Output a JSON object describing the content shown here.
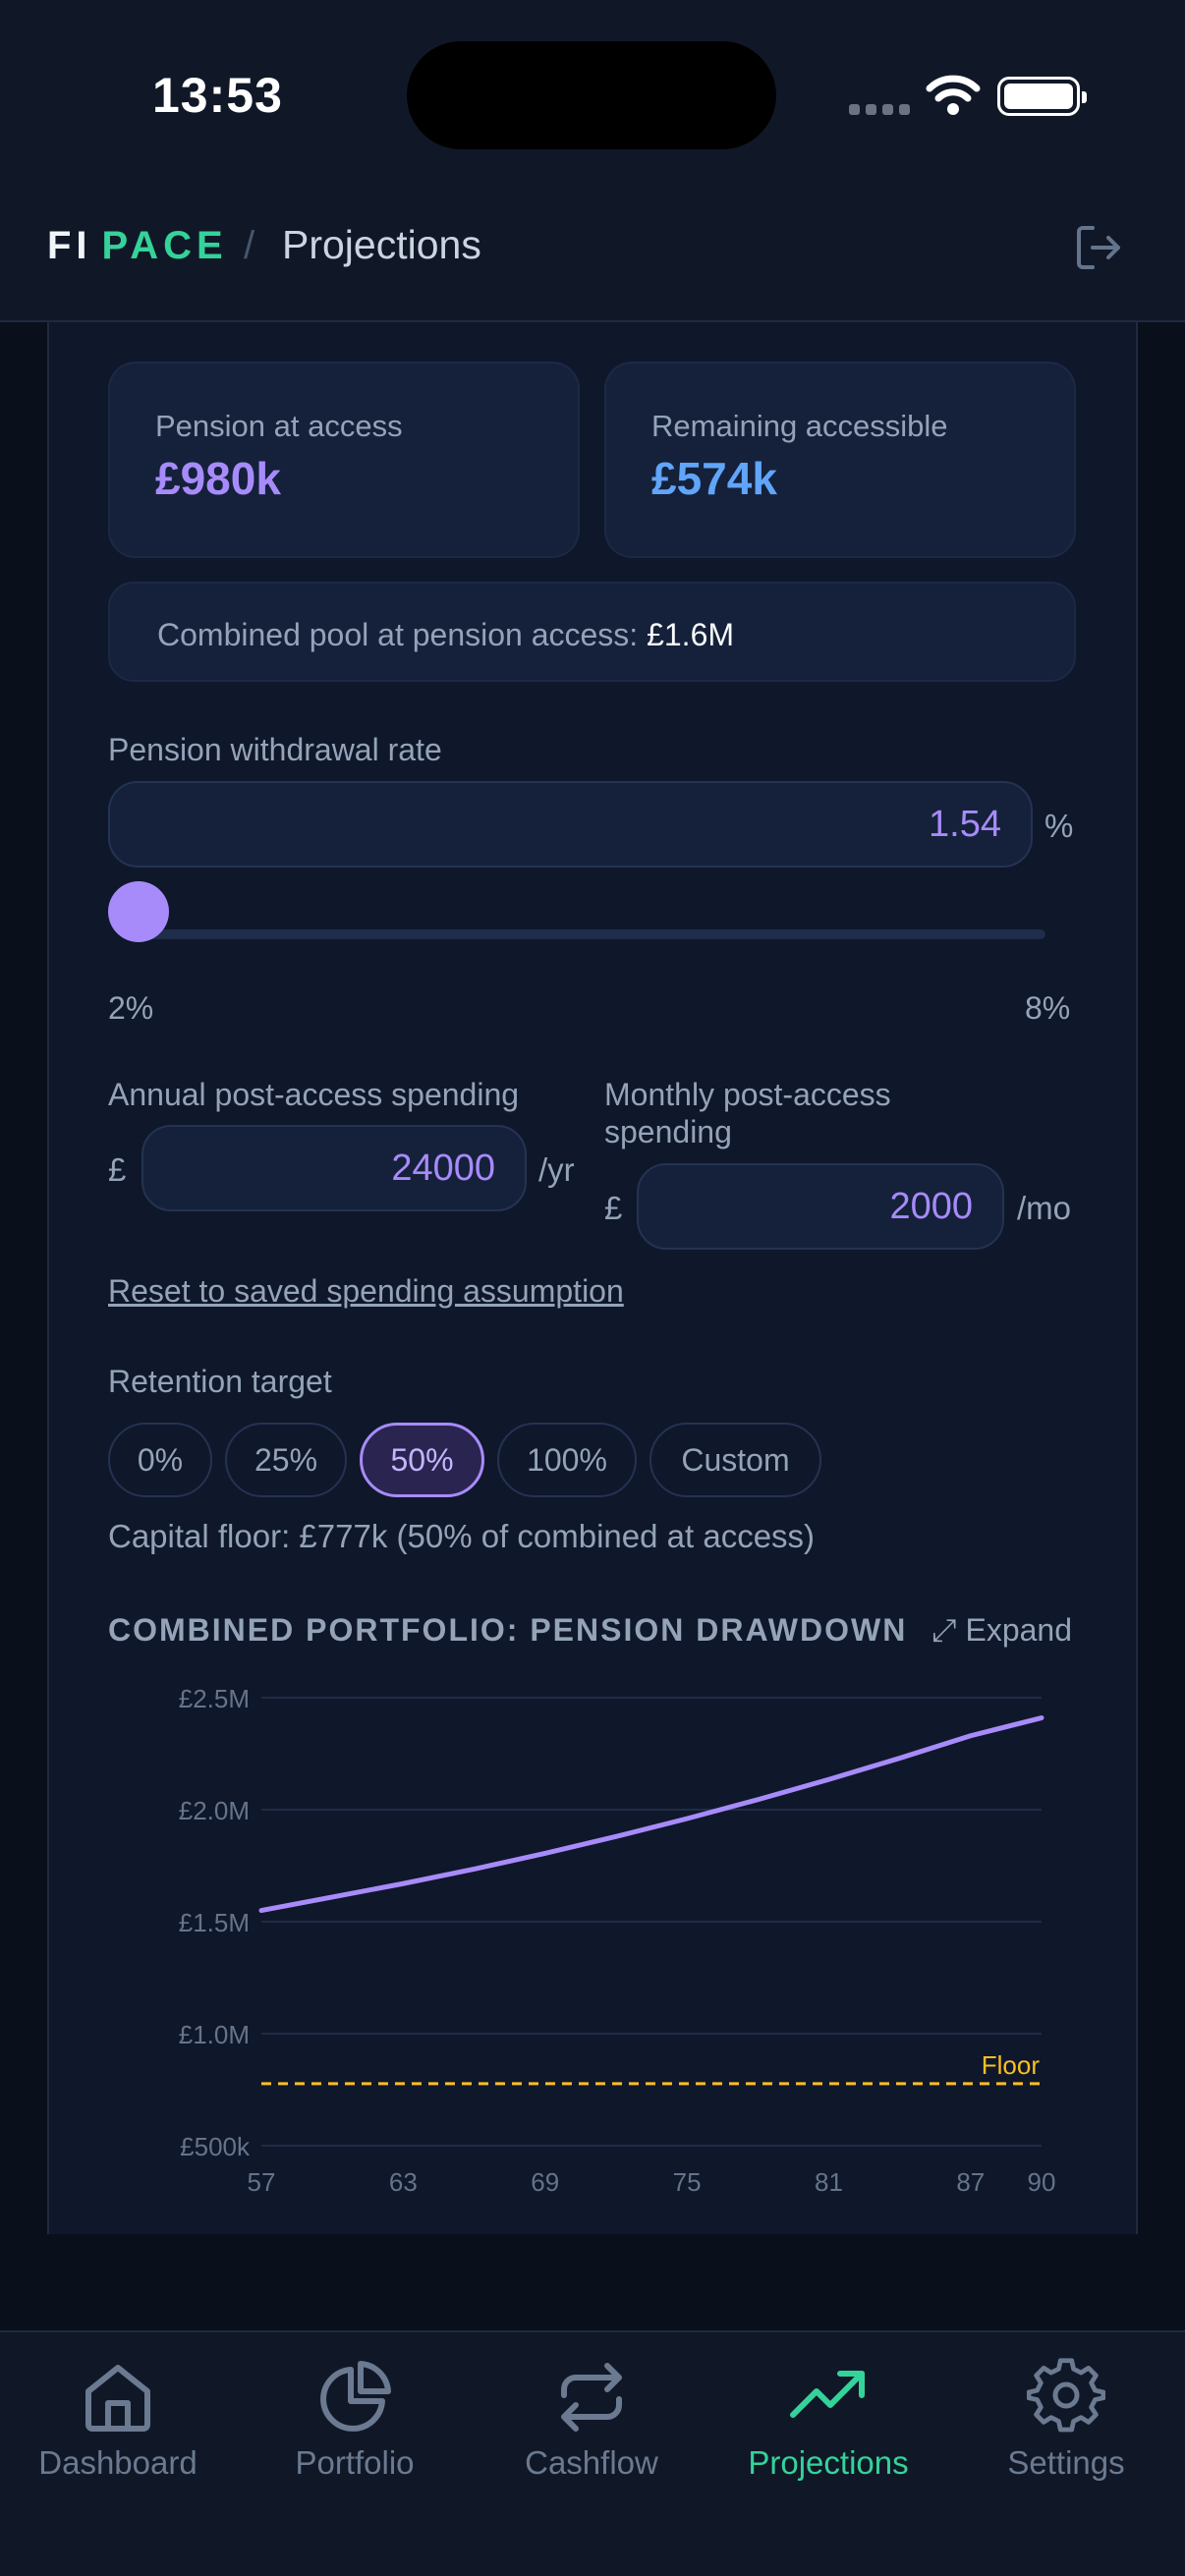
{
  "status": {
    "time": "13:53"
  },
  "header": {
    "brand_primary": "FI",
    "brand_accent": "PACE",
    "separator": "/",
    "page": "Projections"
  },
  "summary": {
    "pension_label": "Pension at access",
    "pension_value": "£980k",
    "remaining_label": "Remaining accessible",
    "remaining_value": "£574k",
    "combined_label": "Combined pool at pension access:",
    "combined_value": "£1.6M"
  },
  "withdrawal": {
    "label": "Pension withdrawal rate",
    "value": "1.54",
    "unit": "%",
    "min_label": "2%",
    "max_label": "8%",
    "slider_fraction": 0.0
  },
  "spending": {
    "annual_label": "Annual post-access spending",
    "annual_prefix": "£",
    "annual_value": "24000",
    "annual_unit": "/yr",
    "monthly_label_line1": "Monthly post-access",
    "monthly_label_line2": "spending",
    "monthly_prefix": "£",
    "monthly_value": "2000",
    "monthly_unit": "/mo",
    "reset_label": "Reset to saved spending assumption"
  },
  "retention": {
    "label": "Retention target",
    "options": [
      "0%",
      "25%",
      "50%",
      "100%",
      "Custom"
    ],
    "selected": "50%",
    "floor_text": "Capital floor: £777k (50% of combined at access)"
  },
  "chart_section": {
    "title": "COMBINED PORTFOLIO: PENSION DRAWDOWN",
    "expand_label": "⤢ Expand"
  },
  "chart_data": {
    "type": "line",
    "title": "COMBINED PORTFOLIO: PENSION DRAWDOWN",
    "xlabel": "",
    "ylabel": "",
    "x_ticks": [
      "57",
      "63",
      "69",
      "75",
      "81",
      "87",
      "90"
    ],
    "y_ticks": [
      "£2.5M",
      "£2.0M",
      "£1.5M",
      "£1.0M",
      "£500k"
    ],
    "ylim": [
      500000,
      2500000
    ],
    "xlim": [
      57,
      90
    ],
    "series": [
      {
        "color": "#a78bfa",
        "x": [
          57,
          60,
          63,
          66,
          69,
          72,
          75,
          78,
          81,
          84,
          87,
          90
        ],
        "y": [
          1550000,
          1610000,
          1670000,
          1735000,
          1805000,
          1880000,
          1960000,
          2045000,
          2135000,
          2230000,
          2330000,
          2410000
        ]
      }
    ],
    "floor": {
      "label": "Floor",
      "value": 777000,
      "color": "#fbbf24"
    },
    "grid": true
  },
  "tabs": [
    {
      "label": "Dashboard",
      "icon": "home-icon"
    },
    {
      "label": "Portfolio",
      "icon": "pie-chart-icon"
    },
    {
      "label": "Cashflow",
      "icon": "repeat-icon"
    },
    {
      "label": "Projections",
      "icon": "trending-up-icon",
      "active": true
    },
    {
      "label": "Settings",
      "icon": "gear-icon"
    }
  ],
  "colors": {
    "accent_green": "#34d399",
    "accent_purple": "#a78bfa",
    "accent_blue": "#60a5fa",
    "floor_yellow": "#fbbf24"
  }
}
